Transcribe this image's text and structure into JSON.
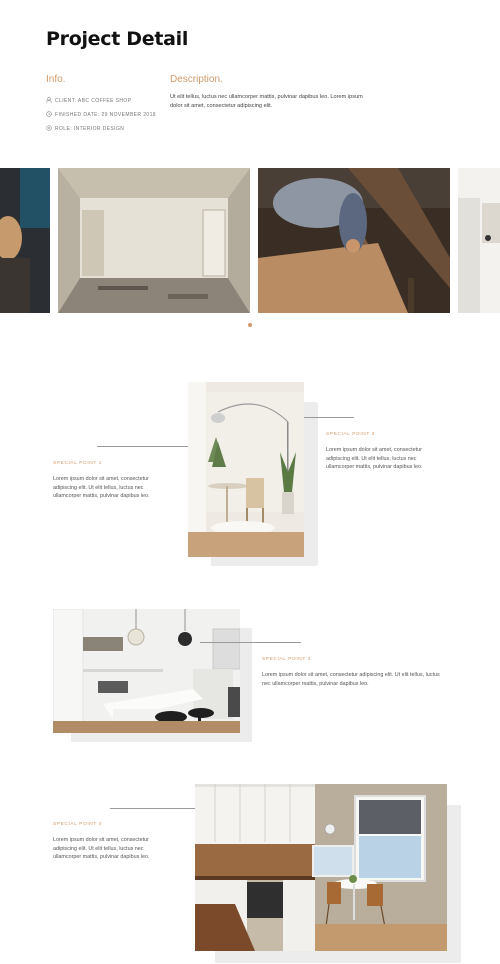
{
  "page": {
    "title": "Project Detail"
  },
  "info": {
    "heading": "Info.",
    "client": "CLIENT: ABC COFFEE SHOP",
    "finished": "FINISHED DATE: 29 NOVEMBER 2018",
    "role": "ROLE: INTERIOR DESIGN"
  },
  "description": {
    "heading": "Description.",
    "text": "Ut elit tellus, luctus nec ullamcorper mattis, pulvinar dapibus leo. Lorem ipsum dolor sit amet, consectetur adipiscing elit."
  },
  "icons": {
    "client": "user-icon",
    "finished": "clock-icon",
    "role": "settings-icon"
  },
  "features": [
    {
      "label": "SPECIAL POINT 1",
      "text": "Lorem ipsum dolor sit amet, consectetur adipiscing elit. Ut elit tellus, luctus nec ullamcorper mattis, pulvinar dapibus leo."
    },
    {
      "label": "SPECIAL POINT 2",
      "text": "Lorem ipsum dolor sit amet, consectetur adipiscing elit. Ut elit tellus, luctus nec ullamcorper mattis, pulvinar dapibus leo."
    },
    {
      "label": "SPECIAL POINT 3",
      "text": "Lorem ipsum dolor sit amet, consectetur adipiscing elit. Ut elit tellus, luctus nec ullamcorper mattis, pulvinar dapibus leo."
    },
    {
      "label": "SPECIAL POINT 4",
      "text": "Lorem ipsum dolor sit amet, consectetur adipiscing elit. Ut elit tellus, luctus nec ullamcorper mattis, pulvinar dapibus leo."
    }
  ],
  "colors": {
    "accent": "#d39a6a",
    "title": "#111111",
    "shadow": "#ececec"
  }
}
